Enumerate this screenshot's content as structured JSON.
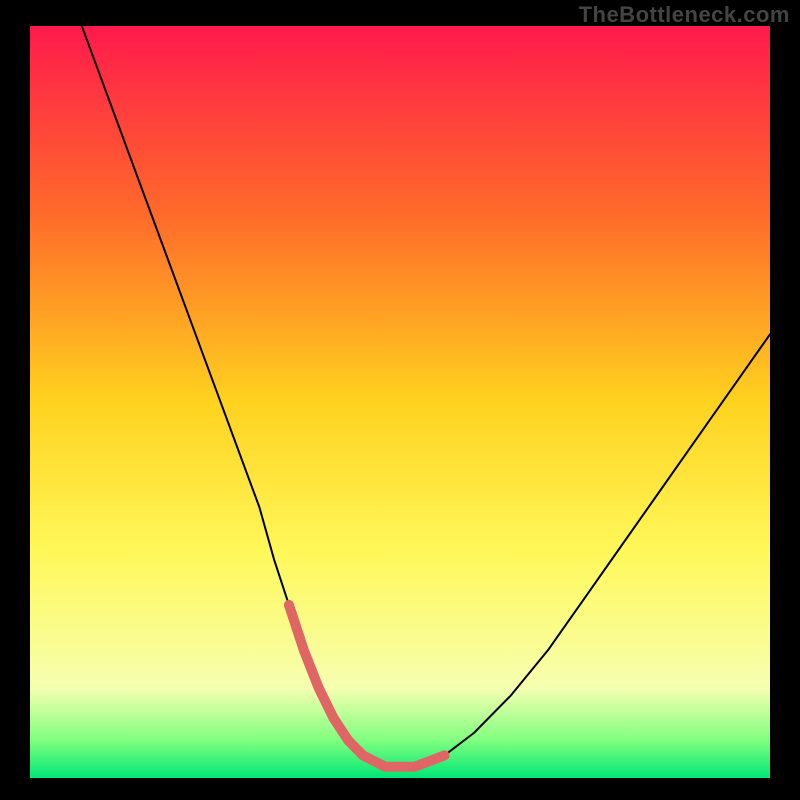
{
  "watermark": "TheBottleneck.com",
  "chart_data": {
    "type": "line",
    "title": "",
    "xlabel": "",
    "ylabel": "",
    "xlim": [
      0,
      100
    ],
    "ylim": [
      0,
      100
    ],
    "background_gradient": {
      "stops": [
        {
          "offset": 0,
          "color": "#ff1a4d"
        },
        {
          "offset": 25,
          "color": "#ff6a2a"
        },
        {
          "offset": 50,
          "color": "#ffd21f"
        },
        {
          "offset": 70,
          "color": "#fff85a"
        },
        {
          "offset": 88,
          "color": "#f6ffb0"
        },
        {
          "offset": 95,
          "color": "#7fff7f"
        },
        {
          "offset": 100,
          "color": "#00e676"
        }
      ]
    },
    "series": [
      {
        "name": "bottleneck-curve",
        "color": "#000000",
        "stroke_width": 2,
        "x": [
          7,
          10,
          13,
          16,
          19,
          22,
          25,
          28,
          31,
          33,
          35,
          37,
          39,
          41,
          43,
          45,
          48,
          52,
          56,
          60,
          65,
          70,
          75,
          80,
          85,
          90,
          95,
          100
        ],
        "y": [
          100,
          92,
          84,
          76,
          68,
          60,
          52,
          44,
          36,
          29,
          23,
          17,
          12,
          8,
          5,
          3,
          1.5,
          1.5,
          3,
          6,
          11,
          17,
          24,
          31,
          38,
          45,
          52,
          59
        ]
      },
      {
        "name": "optimal-zone-highlight",
        "color": "#e06666",
        "stroke_width": 10,
        "x": [
          35,
          37,
          39,
          41,
          43,
          45,
          48,
          52,
          56
        ],
        "y": [
          23,
          17,
          12,
          8,
          5,
          3,
          1.5,
          1.5,
          3
        ]
      }
    ]
  }
}
